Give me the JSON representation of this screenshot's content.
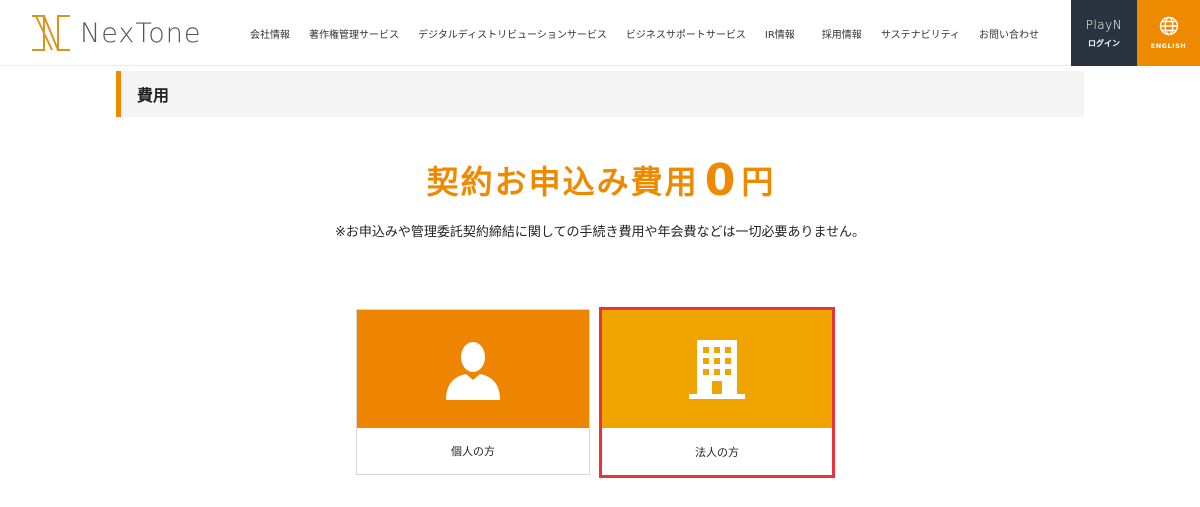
{
  "header": {
    "logo_text": "NexTone",
    "nav": [
      "会社情報",
      "著作権管理サービス",
      "デジタルディストリビューションサービス",
      "ビジネスサポートサービス",
      "IR情報",
      "採用情報",
      "サステナビリティ",
      "お問い合わせ"
    ],
    "playn": {
      "logo": "PlayN",
      "label": "ログイン"
    },
    "english": {
      "label": "ENGLISH"
    }
  },
  "section": {
    "title": "費用"
  },
  "headline": {
    "main": "契約お申込み費用",
    "zero": "0",
    "yen": "円"
  },
  "note": "※お申込みや管理委託契約締結に関しての手続き費用や年会費などは一切必要ありません。",
  "cards": [
    {
      "label": "個人の方"
    },
    {
      "label": "法人の方"
    }
  ],
  "colors": {
    "accent": "#ee8a00",
    "individual_bg": "#ee8500",
    "corporate_bg": "#f0a400",
    "playn_bg": "#2a3340",
    "highlight_border": "#e8333a"
  }
}
